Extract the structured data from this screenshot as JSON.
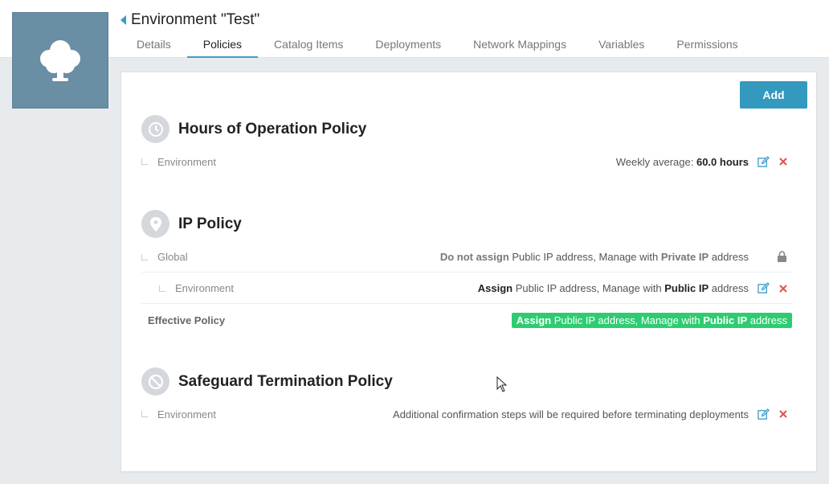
{
  "header": {
    "title": "Environment \"Test\"",
    "tabs": [
      {
        "label": "Details"
      },
      {
        "label": "Policies"
      },
      {
        "label": "Catalog Items"
      },
      {
        "label": "Deployments"
      },
      {
        "label": "Network Mappings"
      },
      {
        "label": "Variables"
      },
      {
        "label": "Permissions"
      }
    ],
    "active_tab": "Policies"
  },
  "toolbar": {
    "add_label": "Add"
  },
  "sections": {
    "hours": {
      "title": "Hours of Operation Policy",
      "icon": "clock-icon",
      "row": {
        "label": "Environment",
        "value_prefix": "Weekly average: ",
        "value_strong": "60.0 hours"
      }
    },
    "ip": {
      "title": "IP Policy",
      "icon": "location-pin-icon",
      "global": {
        "label": "Global",
        "p1": "Do not assign",
        "t1": " Public IP address, Manage with ",
        "p2": "Private IP",
        "t2": " address"
      },
      "environment": {
        "label": "Environment",
        "p1": "Assign",
        "t1": " Public IP address, Manage with ",
        "p2": "Public IP",
        "t2": " address"
      },
      "effective": {
        "label": "Effective Policy",
        "p1": "Assign",
        "t1": " Public IP address, Manage with ",
        "p2": "Public IP",
        "t2": " address"
      }
    },
    "safeguard": {
      "title": "Safeguard Termination Policy",
      "icon": "no-entry-icon",
      "row": {
        "label": "Environment",
        "value": "Additional confirmation steps will be required before terminating deployments"
      }
    }
  },
  "colors": {
    "accent": "#3399bf",
    "tile": "#6a8ea3",
    "effective_badge": "#2ecc71",
    "delete": "#e0524c",
    "edit": "#3a9bc9"
  }
}
